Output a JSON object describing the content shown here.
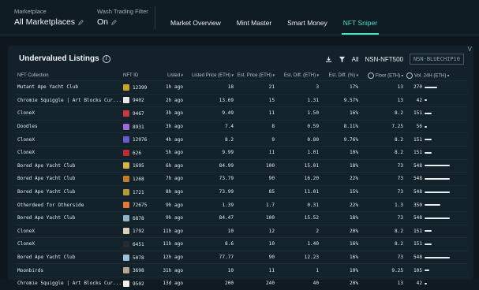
{
  "header": {
    "marketplace_label": "Marketplace",
    "marketplace_value": "All Marketplaces",
    "wash_label": "Wash Trading Filter",
    "wash_value": "On",
    "tabs": [
      "Market Overview",
      "Mint Master",
      "Smart Money",
      "NFT Sniper"
    ],
    "active_tab": "NFT Sniper"
  },
  "panel": {
    "title": "Undervalued Listings",
    "filter_all": "All",
    "filter_nsn": "NSN-NFT500",
    "filter_box": "NSN-BLUECHIP10",
    "caret": "V"
  },
  "columns": [
    "NFT Collection",
    "NFT ID",
    "Listed",
    "Listed Price (ETH)",
    "Est. Price (ETH)",
    "Est. Diff. (ETH)",
    "Est. Diff. (%)",
    "Floor (ETH)",
    "Vol. 24H (ETH)"
  ],
  "column_arrows": [
    "",
    "",
    "▾",
    "▾",
    "▾",
    "▾",
    "▾",
    "▾",
    "▾"
  ],
  "rows": [
    {
      "collection": "Mutant Ape Yacht Club",
      "id": "12399",
      "listed": "1h ago",
      "price": "18",
      "est": "21",
      "diff": "3",
      "pct": "17%",
      "floor": "13",
      "vol": "270",
      "volfrac": 0.5,
      "color": "#c9a227"
    },
    {
      "collection": "Chromie Squiggle | Art Blocks Cur...",
      "id": "9402",
      "listed": "2h ago",
      "price": "13.69",
      "est": "15",
      "diff": "1.31",
      "pct": "9.57%",
      "floor": "13",
      "vol": "42",
      "volfrac": 0.08,
      "color": "#e8e8e8"
    },
    {
      "collection": "CloneX",
      "id": "9467",
      "listed": "3h ago",
      "price": "9.49",
      "est": "11",
      "diff": "1.50",
      "pct": "16%",
      "floor": "8.2",
      "vol": "151",
      "volfrac": 0.28,
      "color": "#c63b3b"
    },
    {
      "collection": "Doodles",
      "id": "8931",
      "listed": "3h ago",
      "price": "7.4",
      "est": "8",
      "diff": "0.59",
      "pct": "8.11%",
      "floor": "7.25",
      "vol": "56",
      "volfrac": 0.1,
      "color": "#9b6ad6"
    },
    {
      "collection": "CloneX",
      "id": "12976",
      "listed": "4h ago",
      "price": "8.2",
      "est": "9",
      "diff": "0.80",
      "pct": "9.76%",
      "floor": "8.2",
      "vol": "151",
      "volfrac": 0.28,
      "color": "#6b5ad6"
    },
    {
      "collection": "CloneX",
      "id": "626",
      "listed": "5h ago",
      "price": "9.99",
      "est": "11",
      "diff": "1.01",
      "pct": "10%",
      "floor": "8.2",
      "vol": "151",
      "volfrac": 0.28,
      "color": "#b7302c"
    },
    {
      "collection": "Bored Ape Yacht Club",
      "id": "1695",
      "listed": "6h ago",
      "price": "84.99",
      "est": "100",
      "diff": "15.01",
      "pct": "18%",
      "floor": "73",
      "vol": "548",
      "volfrac": 1.0,
      "color": "#d8b44a"
    },
    {
      "collection": "Bored Ape Yacht Club",
      "id": "1268",
      "listed": "7h ago",
      "price": "73.79",
      "est": "90",
      "diff": "16.20",
      "pct": "22%",
      "floor": "73",
      "vol": "548",
      "volfrac": 1.0,
      "color": "#c77b2a"
    },
    {
      "collection": "Bored Ape Yacht Club",
      "id": "1721",
      "listed": "8h ago",
      "price": "73.99",
      "est": "85",
      "diff": "11.01",
      "pct": "15%",
      "floor": "73",
      "vol": "548",
      "volfrac": 1.0,
      "color": "#b59a3a"
    },
    {
      "collection": "Otherdeed for Otherside",
      "id": "72675",
      "listed": "9h ago",
      "price": "1.39",
      "est": "1.7",
      "diff": "0.31",
      "pct": "22%",
      "floor": "1.3",
      "vol": "350",
      "volfrac": 0.64,
      "color": "#e07a3a"
    },
    {
      "collection": "Bored Ape Yacht Club",
      "id": "6878",
      "listed": "9h ago",
      "price": "84.47",
      "est": "100",
      "diff": "15.52",
      "pct": "18%",
      "floor": "73",
      "vol": "548",
      "volfrac": 1.0,
      "color": "#8fb4c8"
    },
    {
      "collection": "CloneX",
      "id": "1792",
      "listed": "11h ago",
      "price": "10",
      "est": "12",
      "diff": "2",
      "pct": "20%",
      "floor": "8.2",
      "vol": "151",
      "volfrac": 0.28,
      "color": "#d9d2c4"
    },
    {
      "collection": "CloneX",
      "id": "6451",
      "listed": "11h ago",
      "price": "8.6",
      "est": "10",
      "diff": "1.40",
      "pct": "16%",
      "floor": "8.2",
      "vol": "151",
      "volfrac": 0.28,
      "color": "#2b2b2b"
    },
    {
      "collection": "Bored Ape Yacht Club",
      "id": "5078",
      "listed": "12h ago",
      "price": "77.77",
      "est": "90",
      "diff": "12.23",
      "pct": "16%",
      "floor": "73",
      "vol": "548",
      "volfrac": 1.0,
      "color": "#9cc0d8"
    },
    {
      "collection": "Moonbirds",
      "id": "3698",
      "listed": "31h ago",
      "price": "10",
      "est": "11",
      "diff": "1",
      "pct": "10%",
      "floor": "9.25",
      "vol": "105",
      "volfrac": 0.19,
      "color": "#b9a68a"
    },
    {
      "collection": "Chromie Squiggle | Art Blocks Cur...",
      "id": "9502",
      "listed": "13d ago",
      "price": "200",
      "est": "240",
      "diff": "40",
      "pct": "20%",
      "floor": "13",
      "vol": "42",
      "volfrac": 0.08,
      "color": "#f0f0f0"
    }
  ]
}
